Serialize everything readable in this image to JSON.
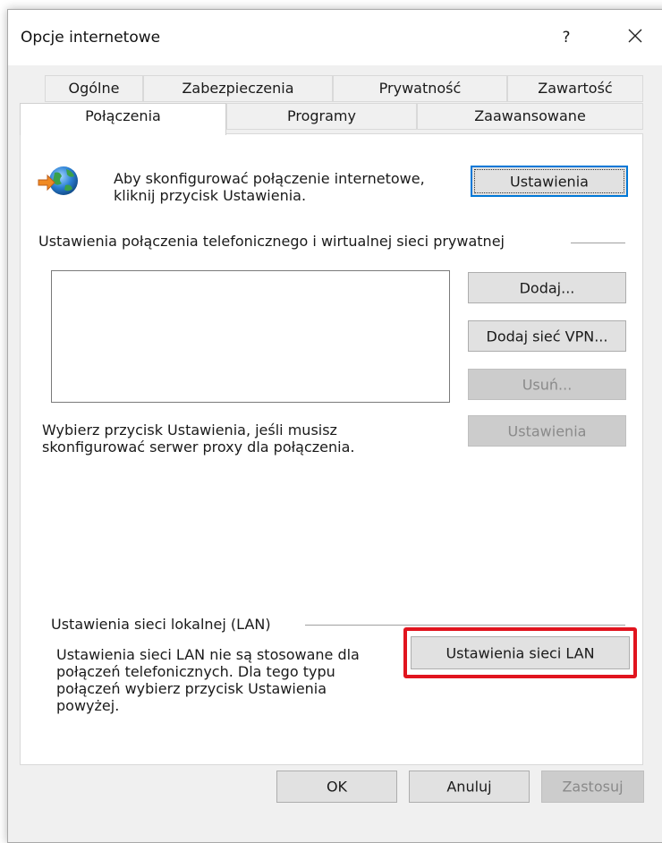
{
  "window": {
    "title": "Opcje internetowe",
    "help_label": "?"
  },
  "tabs_row1": [
    "Ogólne",
    "Zabezpieczenia",
    "Prywatność",
    "Zawartość"
  ],
  "tabs_row2": [
    "Połączenia",
    "Programy",
    "Zaawansowane"
  ],
  "active_tab": "Połączenia",
  "setup": {
    "text": "Aby skonfigurować połączenie internetowe,\nkliknij przycisk Ustawienia.",
    "button_label": "Ustawienia"
  },
  "dialup": {
    "heading": "Ustawienia połączenia telefonicznego i wirtualnej sieci prywatnej",
    "buttons": {
      "add": "Dodaj...",
      "add_vpn": "Dodaj sieć VPN...",
      "remove": "Usuń...",
      "settings": "Ustawienia"
    },
    "proxy_text": "Wybierz przycisk Ustawienia, jeśli musisz\nskonfigurować serwer proxy dla połączenia."
  },
  "lan": {
    "heading": "Ustawienia sieci lokalnej (LAN)",
    "text": "Ustawienia sieci LAN nie są stosowane dla\npołączeń telefonicznych. Dla tego typu\npołączeń wybierz przycisk Ustawienia\npowyżej.",
    "button_label": "Ustawienia sieci LAN",
    "highlight_color": "#e1141e"
  },
  "footer": {
    "ok": "OK",
    "cancel": "Anuluj",
    "apply": "Zastosuj"
  },
  "icons": {
    "connection": "globe-connection-icon",
    "close": "close-icon"
  }
}
